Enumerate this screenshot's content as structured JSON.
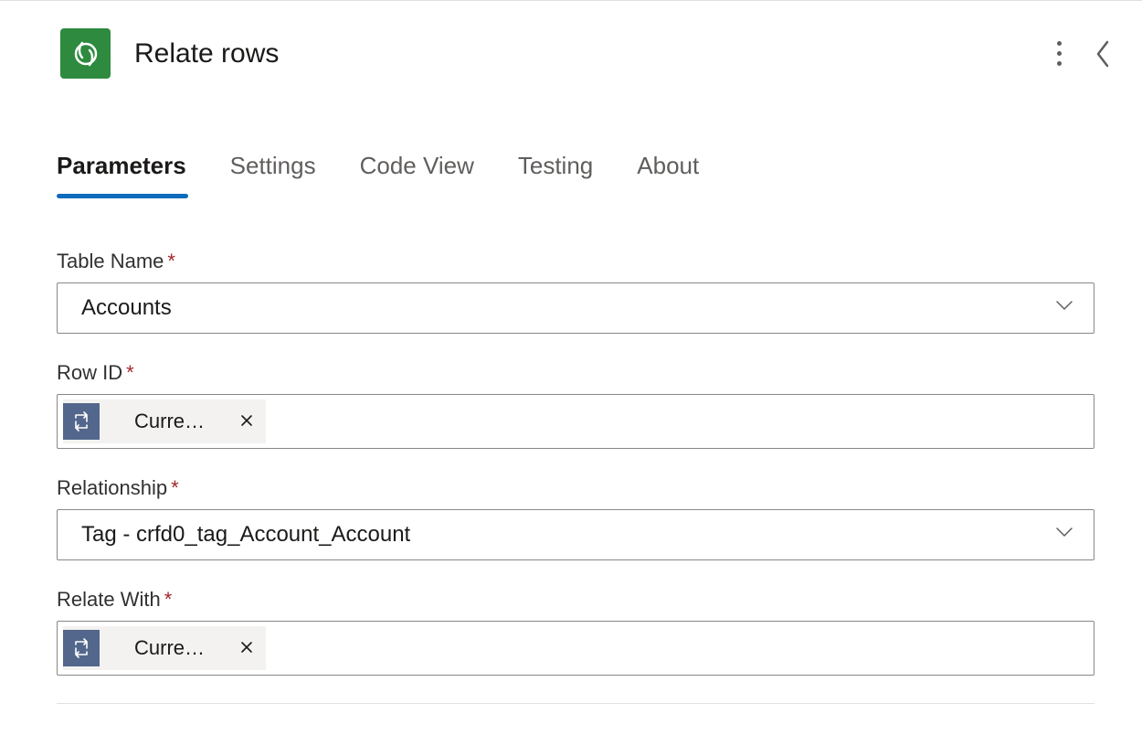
{
  "header": {
    "title": "Relate rows"
  },
  "tabs": [
    {
      "label": "Parameters",
      "active": true
    },
    {
      "label": "Settings",
      "active": false
    },
    {
      "label": "Code View",
      "active": false
    },
    {
      "label": "Testing",
      "active": false
    },
    {
      "label": "About",
      "active": false
    }
  ],
  "fields": {
    "tableName": {
      "label": "Table Name",
      "value": "Accounts"
    },
    "rowId": {
      "label": "Row ID",
      "tokenLabel": "Current i…"
    },
    "relationship": {
      "label": "Relationship",
      "value": "Tag - crfd0_tag_Account_Account"
    },
    "relateWith": {
      "label": "Relate With",
      "tokenLabel": "Current i…"
    }
  }
}
